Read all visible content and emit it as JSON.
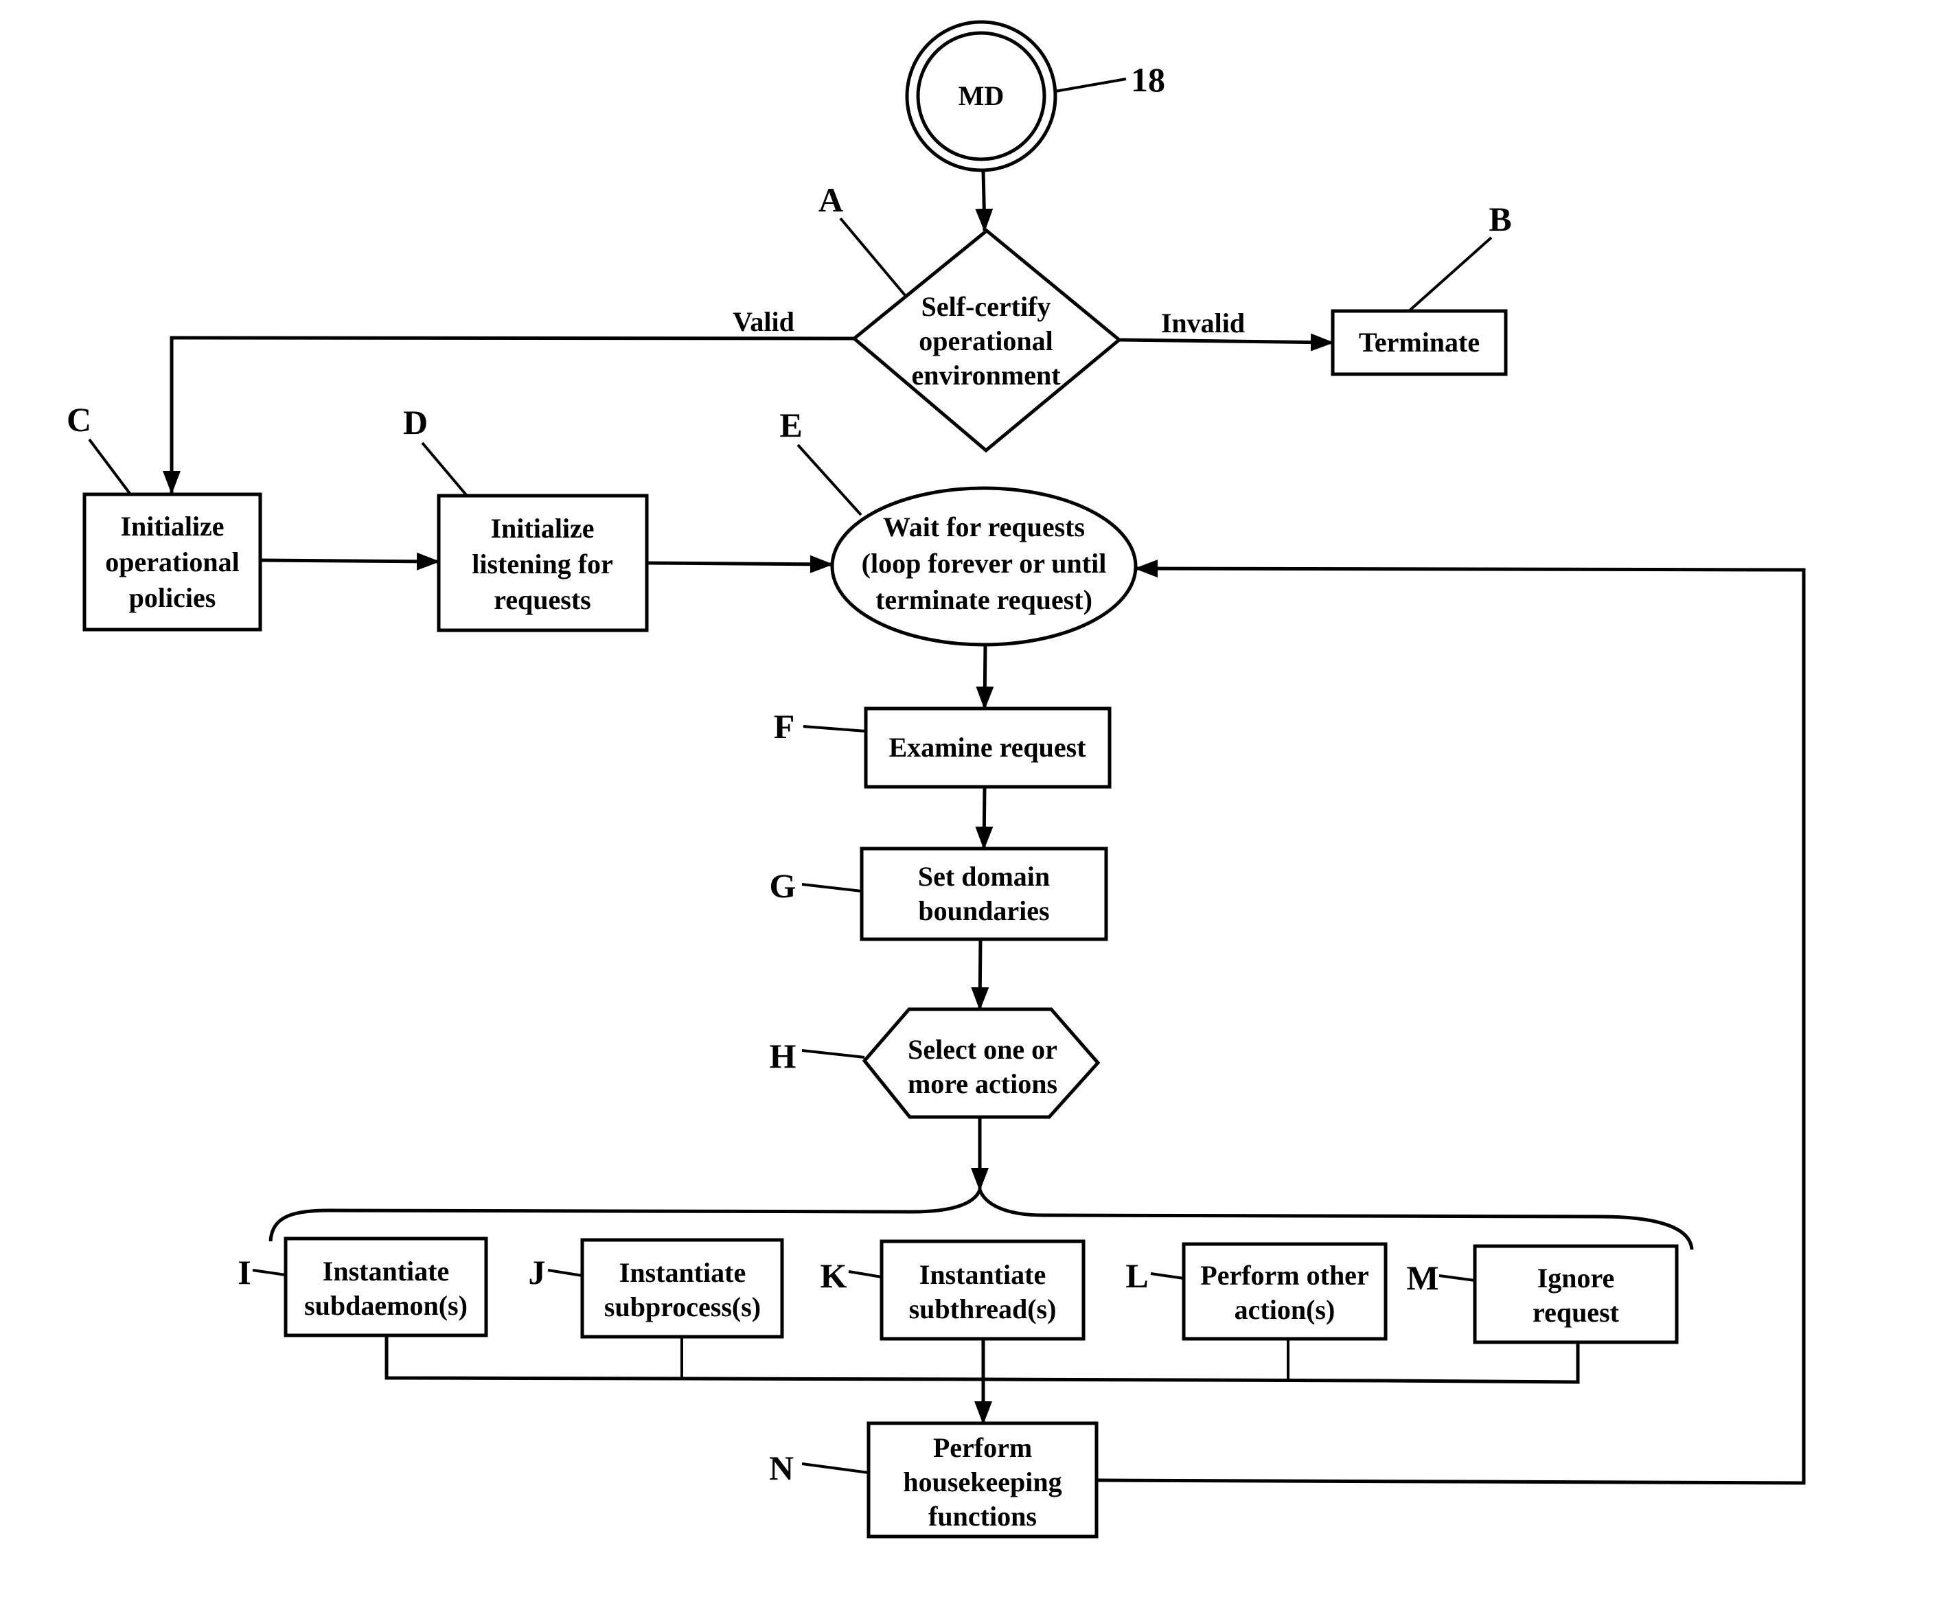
{
  "diagram": {
    "start_node": {
      "label": "MD",
      "ref": "18"
    },
    "nodes": {
      "A": {
        "ref": "A",
        "lines": [
          "Self-certify",
          "operational",
          "environment"
        ]
      },
      "B": {
        "ref": "B",
        "lines": [
          "Terminate"
        ]
      },
      "C": {
        "ref": "C",
        "lines": [
          "Initialize",
          "operational",
          "policies"
        ]
      },
      "D": {
        "ref": "D",
        "lines": [
          "Initialize",
          "listening for",
          "requests"
        ]
      },
      "E": {
        "ref": "E",
        "lines": [
          "Wait for requests",
          "(loop forever or until",
          "terminate request)"
        ]
      },
      "F": {
        "ref": "F",
        "lines": [
          "Examine request"
        ]
      },
      "G": {
        "ref": "G",
        "lines": [
          "Set domain",
          "boundaries"
        ]
      },
      "H": {
        "ref": "H",
        "lines": [
          "Select one or",
          "more actions"
        ]
      },
      "I": {
        "ref": "I",
        "lines": [
          "Instantiate",
          "subdaemon(s)"
        ]
      },
      "J": {
        "ref": "J",
        "lines": [
          "Instantiate",
          "subprocess(s)"
        ]
      },
      "K": {
        "ref": "K",
        "lines": [
          "Instantiate",
          "subthread(s)"
        ]
      },
      "L": {
        "ref": "L",
        "lines": [
          "Perform other",
          "action(s)"
        ]
      },
      "M": {
        "ref": "M",
        "lines": [
          "Ignore",
          "request"
        ]
      },
      "N": {
        "ref": "N",
        "lines": [
          "Perform",
          "housekeeping",
          "functions"
        ]
      }
    },
    "edge_labels": {
      "valid": "Valid",
      "invalid": "Invalid"
    },
    "edges": [
      {
        "from": "MD",
        "to": "A"
      },
      {
        "from": "A",
        "to": "C",
        "label": "Valid"
      },
      {
        "from": "A",
        "to": "B",
        "label": "Invalid"
      },
      {
        "from": "C",
        "to": "D"
      },
      {
        "from": "D",
        "to": "E"
      },
      {
        "from": "E",
        "to": "F"
      },
      {
        "from": "F",
        "to": "G"
      },
      {
        "from": "G",
        "to": "H"
      },
      {
        "from": "H",
        "to": [
          "I",
          "J",
          "K",
          "L",
          "M"
        ]
      },
      {
        "from": [
          "I",
          "J",
          "K",
          "L",
          "M"
        ],
        "to": "N"
      },
      {
        "from": "N",
        "to": "E"
      }
    ]
  }
}
